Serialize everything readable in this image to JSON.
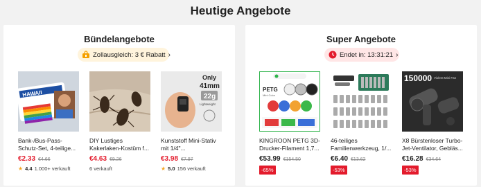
{
  "heading": "Heutige Angebote",
  "bundle": {
    "title": "Bündelangebote",
    "pill_text": "Zollausgleich: 3 € Rabatt",
    "products": [
      {
        "name": "Bank-/Bus-Pass-Schutz-Set, 4-teilige...",
        "price": "€2.33",
        "old": "€4.66",
        "rating": "4.4",
        "sold": "1.000+ verkauft"
      },
      {
        "name": "DIY Lustiges Kakerlaken-Kostüm f...",
        "price": "€4.63",
        "old": "€9.26",
        "sold": "6 verkauft"
      },
      {
        "name": "Kunststoff Mini-Stativ mit 1/4\"...",
        "price": "€3.98",
        "old": "€7.97",
        "rating": "5.0",
        "sold": "156 verkauft"
      }
    ]
  },
  "deals": {
    "title": "Super Angebote",
    "pill_text": "Endet in: 13:31:21",
    "products": [
      {
        "name": "KINGROON PETG 3D-Drucker-Filament 1,7...",
        "price": "€53.99",
        "old": "€154.50",
        "discount": "-65%"
      },
      {
        "name": "46-teiliges Familienwerkzeug, 1/...",
        "price": "€6.40",
        "old": "€13.62",
        "discount": "-53%"
      },
      {
        "name": "X8 Bürstenloser Turbo-Jet-Ventilator, Gebläs...",
        "price": "€16.28",
        "old": "€34.64",
        "discount": "-53%"
      }
    ]
  },
  "image_text": {
    "tripod_line1": "Only",
    "tripod_line2": "41mm",
    "tripod_line3": "22g",
    "tripod_line4": "Lightweight",
    "filament_label": "PETG",
    "filament_sub": "Mini Color",
    "fan_top": "150000",
    "fan_sub": "Violent Mini Fan",
    "card_top": "HAWAII"
  },
  "colors": {
    "price_red": "#e31b2c",
    "star": "#f5a623",
    "bundle_pill": "#fff4dc",
    "deal_pill": "#ffe6e6"
  }
}
